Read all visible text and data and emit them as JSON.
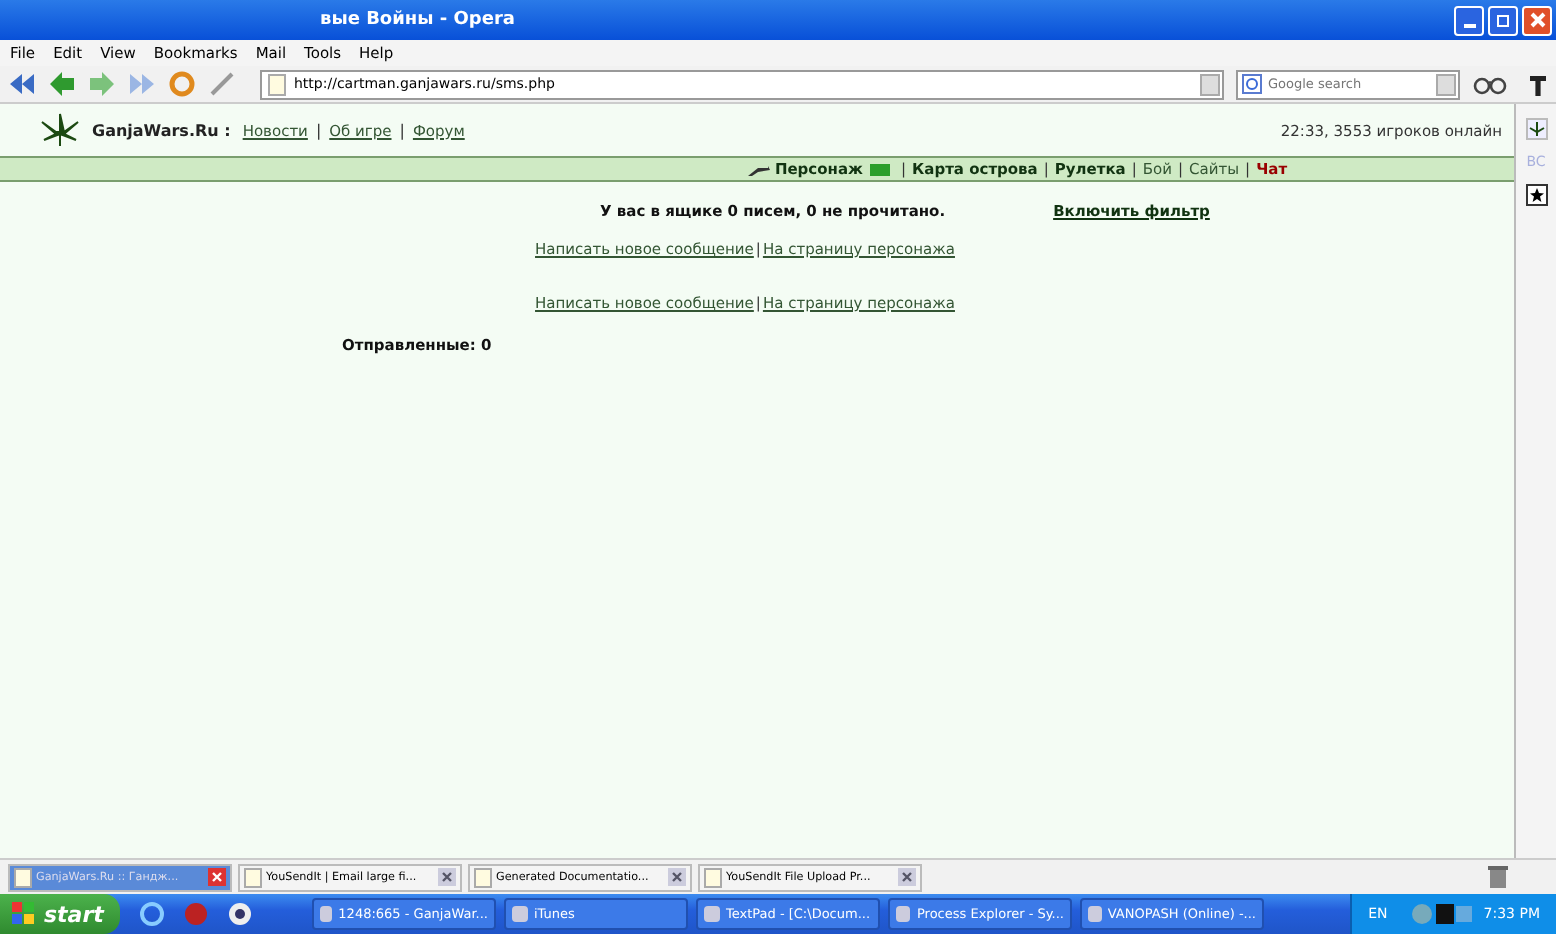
{
  "window": {
    "title": "вые Войны - Opera"
  },
  "menu": [
    "File",
    "Edit",
    "View",
    "Bookmarks",
    "Mail",
    "Tools",
    "Help"
  ],
  "toolbar": {
    "address": "http://cartman.ganjawars.ru/sms.php",
    "search_placeholder": "Google search"
  },
  "side_panel": {
    "label": "BC"
  },
  "site": {
    "logo": "GanjaWars.Ru :",
    "separator": "|",
    "links": [
      "Новости",
      "Об игре",
      "Форум"
    ],
    "status": "22:33, 3553 игроков онлайн"
  },
  "nav": [
    {
      "label": "Персонаж",
      "kind": "strong"
    },
    {
      "label": "Карта острова",
      "kind": "strong"
    },
    {
      "label": "Рулетка",
      "kind": "strong"
    },
    {
      "label": "Бой",
      "kind": "plain"
    },
    {
      "label": "Сайты",
      "kind": "plain"
    },
    {
      "label": "Чат",
      "kind": "alert"
    }
  ],
  "content": {
    "inbox": "У вас в ящике 0 писем, 0 не прочитано.",
    "filter": "Включить фильтр",
    "link_rows": [
      [
        "Написать новое сообщение",
        "На страницу персонажа"
      ],
      [
        "Написать новое сообщение",
        "На страницу персонажа"
      ]
    ],
    "sent": "Отправленные: 0"
  },
  "tabs": [
    {
      "label": "GanjaWars.Ru :: Гандж...",
      "selected": true
    },
    {
      "label": "YouSendIt | Email large fi...",
      "selected": false
    },
    {
      "label": "Generated Documentatio...",
      "selected": false
    },
    {
      "label": "YouSendIt File Upload Pr...",
      "selected": false
    }
  ],
  "taskbar": {
    "start": "start",
    "tasks": [
      "1248:665 - GanjaWar...",
      "iTunes",
      "TextPad - [C:\\Docum...",
      "Process Explorer - Sy...",
      "VANOPASH (Online) -..."
    ],
    "lang": "EN",
    "clock": "7:33 PM"
  }
}
